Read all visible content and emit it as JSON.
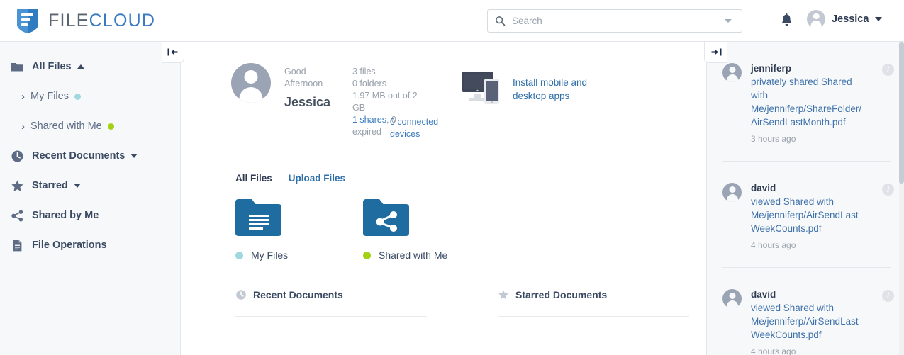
{
  "header": {
    "logo_text_light": "FILE",
    "logo_text_bold": "CLOUD",
    "logo_icon": "filecloud-shield-icon",
    "search": {
      "placeholder": "Search",
      "value": "",
      "icon": "search-icon",
      "caret_icon": "chevron-down-icon"
    },
    "notifications_icon": "bell-icon",
    "user": {
      "name": "Jessica",
      "avatar_icon": "user-avatar-icon",
      "caret_icon": "chevron-down-icon"
    }
  },
  "sidebar": {
    "collapse_button": {
      "icon": "collapse-left-icon",
      "label": "|←"
    },
    "items": [
      {
        "label": "All Files",
        "icon": "folder-icon",
        "caret": "up",
        "type": "parent"
      },
      {
        "label": "My Files",
        "icon": "chevron-right-icon",
        "dot_color": "#9fd8e0",
        "type": "child"
      },
      {
        "label": "Shared with Me",
        "icon": "chevron-right-icon",
        "dot_color": "#a3d117",
        "type": "child"
      },
      {
        "label": "Recent Documents",
        "icon": "clock-icon",
        "caret": "down",
        "type": "parent"
      },
      {
        "label": "Starred",
        "icon": "star-icon",
        "caret": "down",
        "type": "parent"
      },
      {
        "label": "Shared by Me",
        "icon": "share-icon",
        "type": "parent"
      },
      {
        "label": "File Operations",
        "icon": "document-icon",
        "type": "parent"
      }
    ]
  },
  "main": {
    "profile": {
      "avatar_icon": "user-avatar-icon",
      "greeting_line1": "Good",
      "greeting_line2": "Afternoon",
      "name": "Jessica"
    },
    "stats": {
      "files": "3 files",
      "folders": "0 folders",
      "storage": "1.97 MB out of 2 GB",
      "shares_link": "1 shares",
      "shares_rest": ", 0 expired"
    },
    "devices": {
      "connected": "0 connected devices",
      "install_link": "Install mobile and desktop apps",
      "device_icon": "monitor-and-phone-icon"
    },
    "tabs": [
      {
        "label": "All Files",
        "active": true
      },
      {
        "label": "Upload Files",
        "active": false
      }
    ],
    "folders": [
      {
        "label": "My Files",
        "icon": "folder-documents-icon",
        "dot_color": "#9fd8e0"
      },
      {
        "label": "Shared with Me",
        "icon": "folder-shared-icon",
        "dot_color": "#a3d117"
      }
    ],
    "sections": [
      {
        "title": "Recent Documents",
        "icon": "clock-icon"
      },
      {
        "title": "Starred Documents",
        "icon": "star-icon"
      }
    ]
  },
  "activity": {
    "collapse_button": {
      "icon": "collapse-right-icon",
      "label": "→|"
    },
    "items": [
      {
        "user": "jenniferp",
        "text": "privately shared Shared with Me/jenniferp/ShareFolder/AirSendLastMonth.pdf",
        "time": "3 hours ago",
        "info_icon": "info-icon"
      },
      {
        "user": "david",
        "text": "viewed Shared with Me/jenniferp/AirSendLastWeekCounts.pdf",
        "time": "4 hours ago",
        "info_icon": "info-icon"
      },
      {
        "user": "david",
        "text": "viewed Shared with Me/jenniferp/AirSendLastWeekCounts.pdf",
        "time": "4 hours ago",
        "info_icon": "info-icon"
      }
    ]
  },
  "colors": {
    "brand_blue": "#1e6ea7",
    "link_blue": "#2f6fa8",
    "accent_cyan": "#9fd8e0",
    "accent_green": "#a3d117",
    "text_dark": "#2f3b52"
  }
}
